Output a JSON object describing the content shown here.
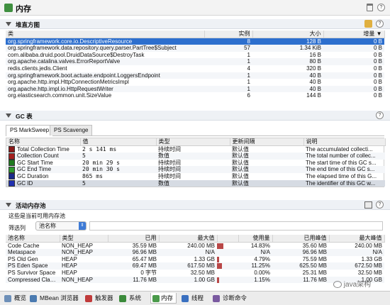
{
  "window": {
    "title": "内存"
  },
  "heap_histogram": {
    "title": "堆直方图",
    "columns": [
      "类",
      "实例",
      "大小",
      "增量"
    ],
    "rows": [
      {
        "cls": "org.springframework.core.io.DescriptiveResource",
        "instances": "8",
        "size": "128 B",
        "delta": "0 B",
        "selected": true
      },
      {
        "cls": "org.springframework.data.repository.query.parser.PartTree$Subject",
        "instances": "57",
        "size": "1.34 KiB",
        "delta": "0 B"
      },
      {
        "cls": "com.alibaba.druid.pool.DruidDataSource$DestroyTask",
        "instances": "1",
        "size": "16 B",
        "delta": "0 B"
      },
      {
        "cls": "org.apache.catalina.valves.ErrorReportValve",
        "instances": "1",
        "size": "80 B",
        "delta": "0 B"
      },
      {
        "cls": "redis.clients.jedis.Client",
        "instances": "4",
        "size": "320 B",
        "delta": "0 B"
      },
      {
        "cls": "org.springframework.boot.actuate.endpoint.LoggersEndpoint",
        "instances": "1",
        "size": "40 B",
        "delta": "0 B"
      },
      {
        "cls": "org.apache.http.impl.HttpConnectionMetricsImpl",
        "instances": "1",
        "size": "40 B",
        "delta": "0 B"
      },
      {
        "cls": "org.apache.http.impl.io.HttpRequestWriter",
        "instances": "1",
        "size": "40 B",
        "delta": "0 B"
      },
      {
        "cls": "org.elasticsearch.common.unit.SizeValue",
        "instances": "6",
        "size": "144 B",
        "delta": "0 B"
      }
    ]
  },
  "gc": {
    "title": "GC 表",
    "tabs": [
      "PS MarkSweep",
      "PS Scavenge"
    ],
    "columns": [
      "名称",
      "值",
      "类型",
      "更新间隔",
      "说明"
    ],
    "rows": [
      {
        "color": "#8b1a1a",
        "name": "Total Collection Time",
        "value": "2 s 141 ms",
        "type": "持续时间",
        "interval": "默认值",
        "desc": "The accumulated collecti..."
      },
      {
        "color": "#a52020",
        "name": "Collection Count",
        "value": "5",
        "type": "数值",
        "interval": "默认值",
        "desc": "The total number of collec..."
      },
      {
        "color": "#1f7a1f",
        "name": "GC Start Time",
        "value": "20 min 29 s",
        "type": "持续时间",
        "interval": "默认值",
        "desc": "The start time of this GC s..."
      },
      {
        "color": "#2e9a2e",
        "name": "GC End Time",
        "value": "20 min 30 s",
        "type": "持续时间",
        "interval": "默认值",
        "desc": "The end time of this GC s..."
      },
      {
        "color": "#1a2a8b",
        "name": "GC Duration",
        "value": "865 ms",
        "type": "持续时间",
        "interval": "默认值",
        "desc": "The elapsed time of this G..."
      },
      {
        "color": "#2030b0",
        "name": "GC ID",
        "value": "5",
        "type": "数值",
        "interval": "默认值",
        "desc": "The identifier of this GC w...",
        "selected": true
      }
    ]
  },
  "pools": {
    "title": "活动内存池",
    "subtitle": "这些是当前可用内存池",
    "filter_label": "筛选列",
    "filter_option": "池名称",
    "columns": [
      "池名称",
      "类型",
      "已用",
      "最大值",
      "",
      "使用量",
      "已用峰值",
      "最大峰值"
    ],
    "rows": [
      {
        "name": "Code Cache",
        "type": "NON_HEAP",
        "used": "35.59 MB",
        "max": "240.00 MB",
        "bar": 0.15,
        "usage": "14.83%",
        "peak_used": "35.60 MB",
        "peak_max": "240.00 MB"
      },
      {
        "name": "Metaspace",
        "type": "NON_HEAP",
        "used": "96.96 MB",
        "max": "N/A",
        "bar": 0,
        "usage": "N/A",
        "peak_used": "96.96 MB",
        "peak_max": "N/A"
      },
      {
        "name": "PS Old Gen",
        "type": "HEAP",
        "used": "65.47 MB",
        "max": "1.33 GB",
        "bar": 0.05,
        "usage": "4.79%",
        "peak_used": "75.59 MB",
        "peak_max": "1.33 GB"
      },
      {
        "name": "PS Eden Space",
        "type": "HEAP",
        "used": "69.47 MB",
        "max": "617.50 MB",
        "bar": 0.11,
        "usage": "11.25%",
        "peak_used": "625.50 MB",
        "peak_max": "672.50 MB"
      },
      {
        "name": "PS Survivor Space",
        "type": "HEAP",
        "used": "0 字节",
        "max": "32.50 MB",
        "bar": 0,
        "usage": "0.00%",
        "peak_used": "25.31 MB",
        "peak_max": "32.50 MB"
      },
      {
        "name": "Compressed Clas...",
        "type": "NON_HEAP",
        "used": "11.76 MB",
        "max": "1.00 GB",
        "bar": 0.01,
        "usage": "1.15%",
        "peak_used": "11.76 MB",
        "peak_max": "1.00 GB"
      }
    ]
  },
  "bottom_tabs": [
    {
      "label": "概览",
      "color": "#6d8fb8"
    },
    {
      "label": "MBean 浏览器",
      "color": "#4a7ab0"
    },
    {
      "label": "触发器",
      "color": "#c03a3a"
    },
    {
      "label": "系统",
      "color": "#3a8a3a"
    },
    {
      "label": "内存",
      "color": "#4a9a4a",
      "active": true
    },
    {
      "label": "线程",
      "color": "#3a70c0"
    },
    {
      "label": "诊断命令",
      "color": "#7a5aa0"
    }
  ],
  "watermark": "java架构"
}
